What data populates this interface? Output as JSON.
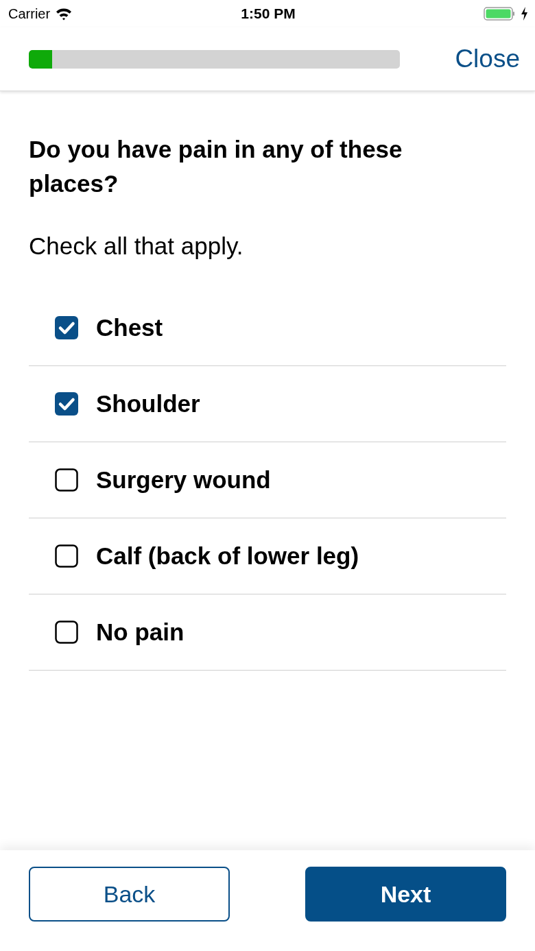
{
  "status_bar": {
    "carrier": "Carrier",
    "time": "1:50 PM"
  },
  "header": {
    "progress": {
      "level": 0.063
    },
    "close_label": "Close"
  },
  "question": {
    "title": "Do you have pain in any of these places?",
    "instruction": "Check all that apply."
  },
  "options": [
    {
      "label": "Chest",
      "checked": true
    },
    {
      "label": "Shoulder",
      "checked": true
    },
    {
      "label": "Surgery wound",
      "checked": false
    },
    {
      "label": "Calf (back of lower leg)",
      "checked": false
    },
    {
      "label": "No pain",
      "checked": false
    }
  ],
  "buttons": [
    {
      "label": "Back",
      "kind": "secondary"
    },
    {
      "label": "Next",
      "kind": "primary"
    }
  ]
}
